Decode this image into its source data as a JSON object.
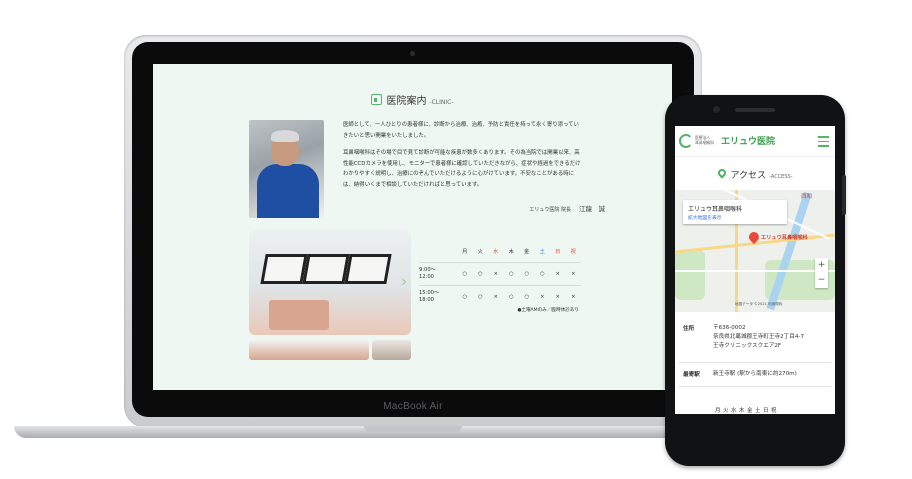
{
  "laptop": {
    "brand": "MacBook Air",
    "section": {
      "title": "医院案内",
      "subtitle": "-CLINIC-"
    },
    "intro": {
      "p1": "医師として、一人ひとりの患者様に、診断から治療、治癒、予防と責任を持って永く寄り添っていきたいと思い開業をいたしました。",
      "p2": "耳鼻咽喉科はその場で目で見て診断が可能な疾患が数多くあります。その為当院では開業以来、高性能CCDカメラを使用し、モニターで患者様に確認していただきながら、症状や経過をできるだけわかりやすく説明し、治療にのぞんでいただけるように心がけています。不安なことがある時には、納得いくまで相談していただければと思っています。"
    },
    "signature": {
      "role": "エリュウ医院 院長",
      "name": "江龍　誠"
    },
    "hours": {
      "days": [
        "月",
        "火",
        "水",
        "木",
        "金",
        "土",
        "日",
        "祝"
      ],
      "rows": [
        {
          "time1": "9:00～",
          "time2": "12:00",
          "marks": [
            "○",
            "○",
            "×",
            "○",
            "○",
            "○",
            "×",
            "×"
          ]
        },
        {
          "time1": "15:00～",
          "time2": "18:00",
          "marks": [
            "○",
            "○",
            "×",
            "○",
            "○",
            "×",
            "×",
            "×"
          ]
        }
      ],
      "note": "●土曜AMのみ／臨時休診あり"
    },
    "colors": {
      "accent": "#5ab36b",
      "background": "#eef7f1",
      "sat": "#2f6de2",
      "sun": "#e2492f"
    }
  },
  "phone": {
    "logo_small_1": "医療法人",
    "logo_small_2": "耳鼻咽喉科",
    "clinic_name": "エリュウ医院",
    "section": {
      "title": "アクセス",
      "subtitle": "-ACCESS-"
    },
    "map": {
      "card_title": "エリュウ耳鼻咽喉科",
      "card_link": "拡大地図を表示",
      "pin_label": "エリュウ耳鼻咽喉科",
      "area_label": "西和",
      "zoom_in": "+",
      "zoom_out": "−",
      "footer": "地図データ ©2021 利用規約"
    },
    "address": {
      "label": "住所",
      "line1": "〒636-0002",
      "line2": "奈良県北葛城郡王寺町王寺2丁目4-7",
      "line3": "王寺クリニックスクエア2F"
    },
    "station": {
      "label": "最寄駅",
      "value": "新王寺駅 (駅から南東に約270m)"
    },
    "days": "月火水木金土日祝"
  }
}
